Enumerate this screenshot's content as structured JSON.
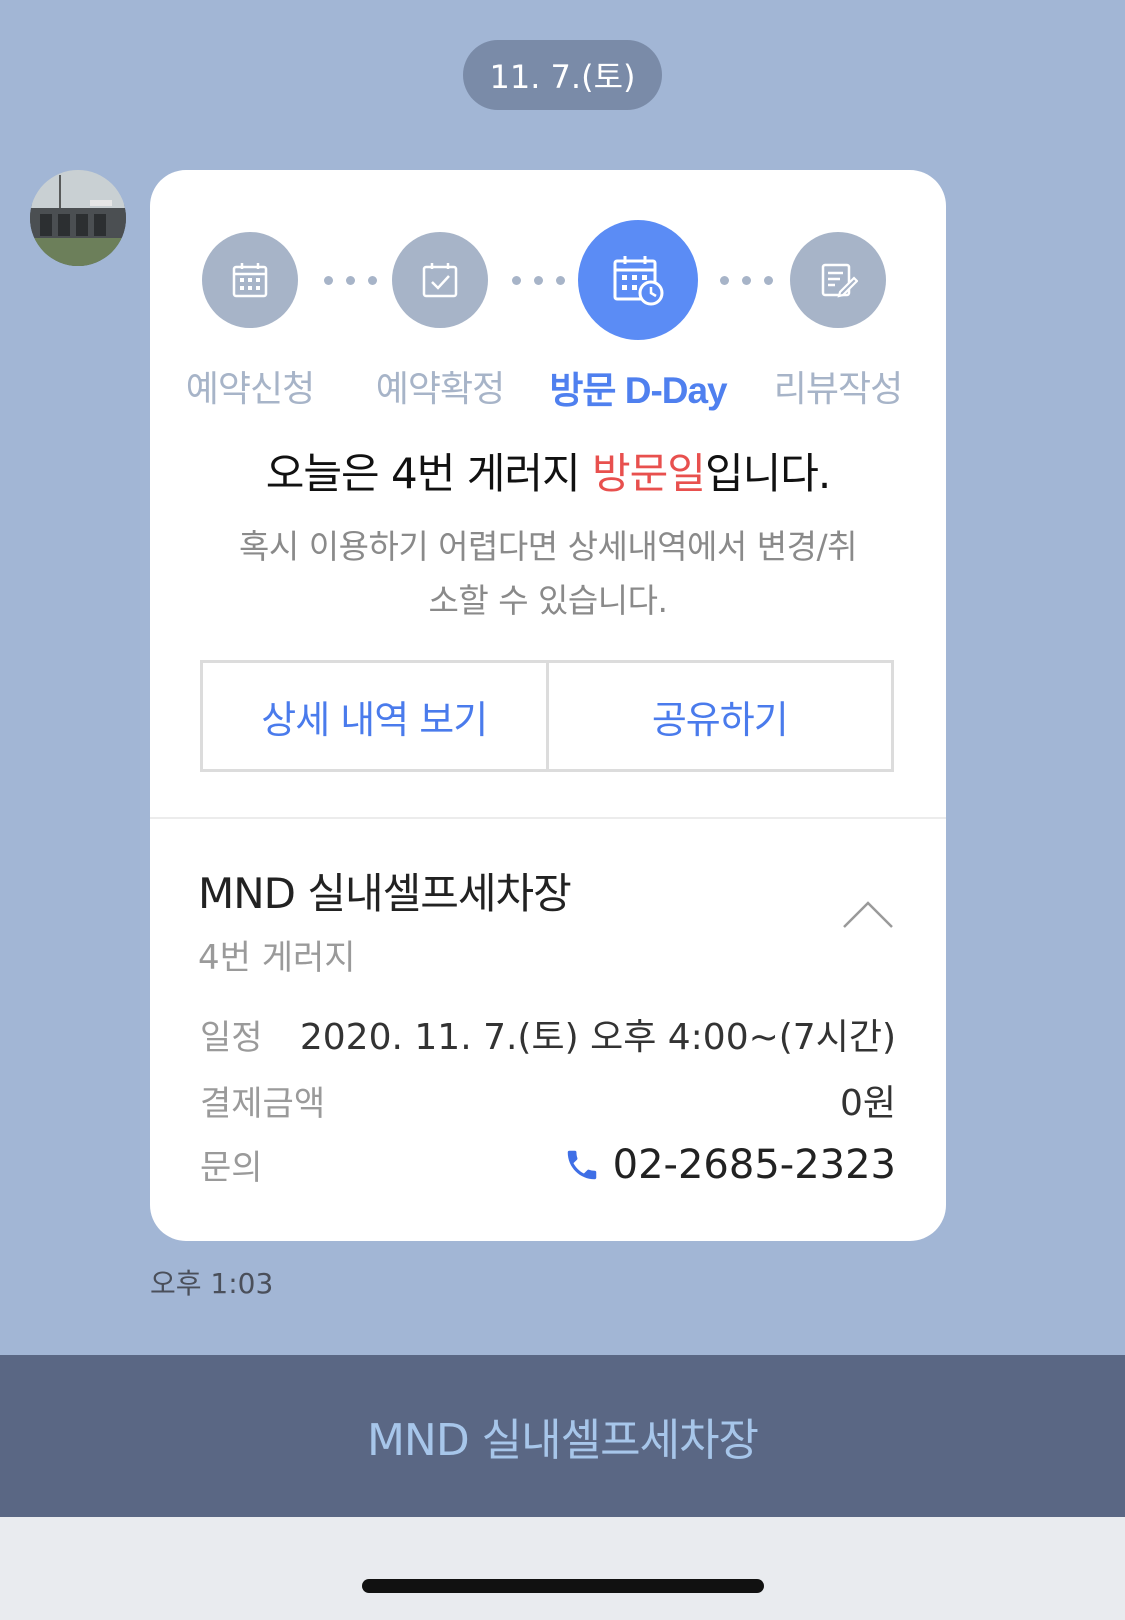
{
  "date_pill": "11. 7.(토)",
  "card": {
    "steps": [
      {
        "label": "예약신청",
        "icon": "calendar-icon",
        "state": "done"
      },
      {
        "label": "예약확정",
        "icon": "calendar-check-icon",
        "state": "done"
      },
      {
        "label": "방문 D-Day",
        "icon": "calendar-clock-icon",
        "state": "active"
      },
      {
        "label": "리뷰작성",
        "icon": "review-edit-icon",
        "state": "pending"
      }
    ],
    "headline_pre": "오늘은 4번 게러지 ",
    "headline_highlight": "방문일",
    "headline_post": "입니다.",
    "subtext_line1": "혹시 이용하기 어렵다면 상세내역에서 변경/취",
    "subtext_line2": "소할 수 있습니다.",
    "buttons": {
      "details": "상세 내역 보기",
      "share": "공유하기"
    },
    "shop_name": "MND 실내셀프세차장",
    "shop_sub": "4번 게러지",
    "schedule_label": "일정",
    "schedule_value": "2020. 11. 7.(토) 오후 4:00~(7시간)",
    "payment_label": "결제금액",
    "payment_value": "0원",
    "inquiry_label": "문의",
    "inquiry_value": "02-2685-2323"
  },
  "timestamp": "오후 1:03",
  "bottom_bar_title": "MND 실내셀프세차장",
  "colors": {
    "background": "#a2b6d5",
    "accent": "#5b8cf5",
    "highlight": "#e8504e",
    "bottom_bar": "#5a6784"
  }
}
